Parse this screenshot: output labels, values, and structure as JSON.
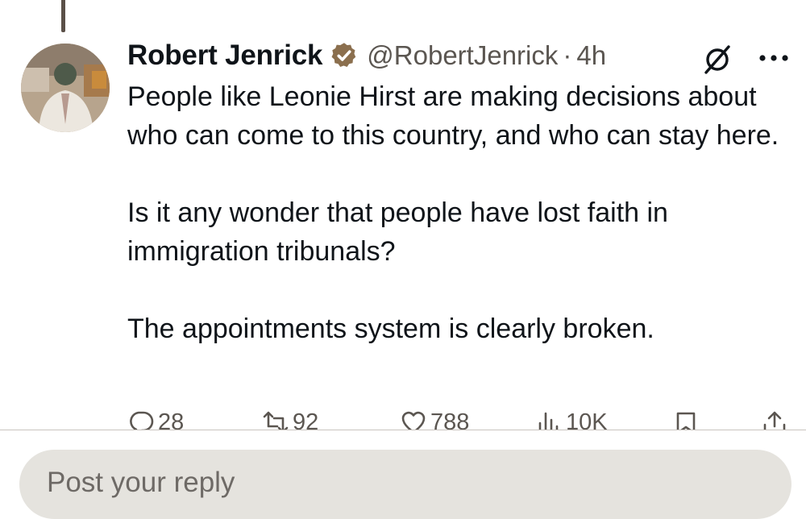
{
  "tweet": {
    "author_name": "Robert Jenrick",
    "handle": "@RobertJenrick",
    "separator": "·",
    "time": "4h",
    "verified_badge_color": "#8b6f4e",
    "paragraphs": [
      "People like Leonie Hirst are making decisions about who can come to this country, and who can stay here.",
      "Is it any wonder that people have lost faith in immigration tribunals?",
      "The appointments system is clearly broken."
    ]
  },
  "actions": {
    "replies": "28",
    "reposts": "92",
    "likes": "788",
    "views": "10K"
  },
  "icons": {
    "grok": "grok-icon",
    "more": "more-icon",
    "reply": "reply-icon",
    "repost": "repost-icon",
    "like": "heart-icon",
    "views": "views-icon",
    "bookmark": "bookmark-icon",
    "share": "share-icon"
  },
  "reply_composer": {
    "placeholder": "Post your reply"
  },
  "colors": {
    "text": "#0f1419",
    "secondary_text": "#5b5651",
    "reply_box_bg": "#e5e3de"
  }
}
